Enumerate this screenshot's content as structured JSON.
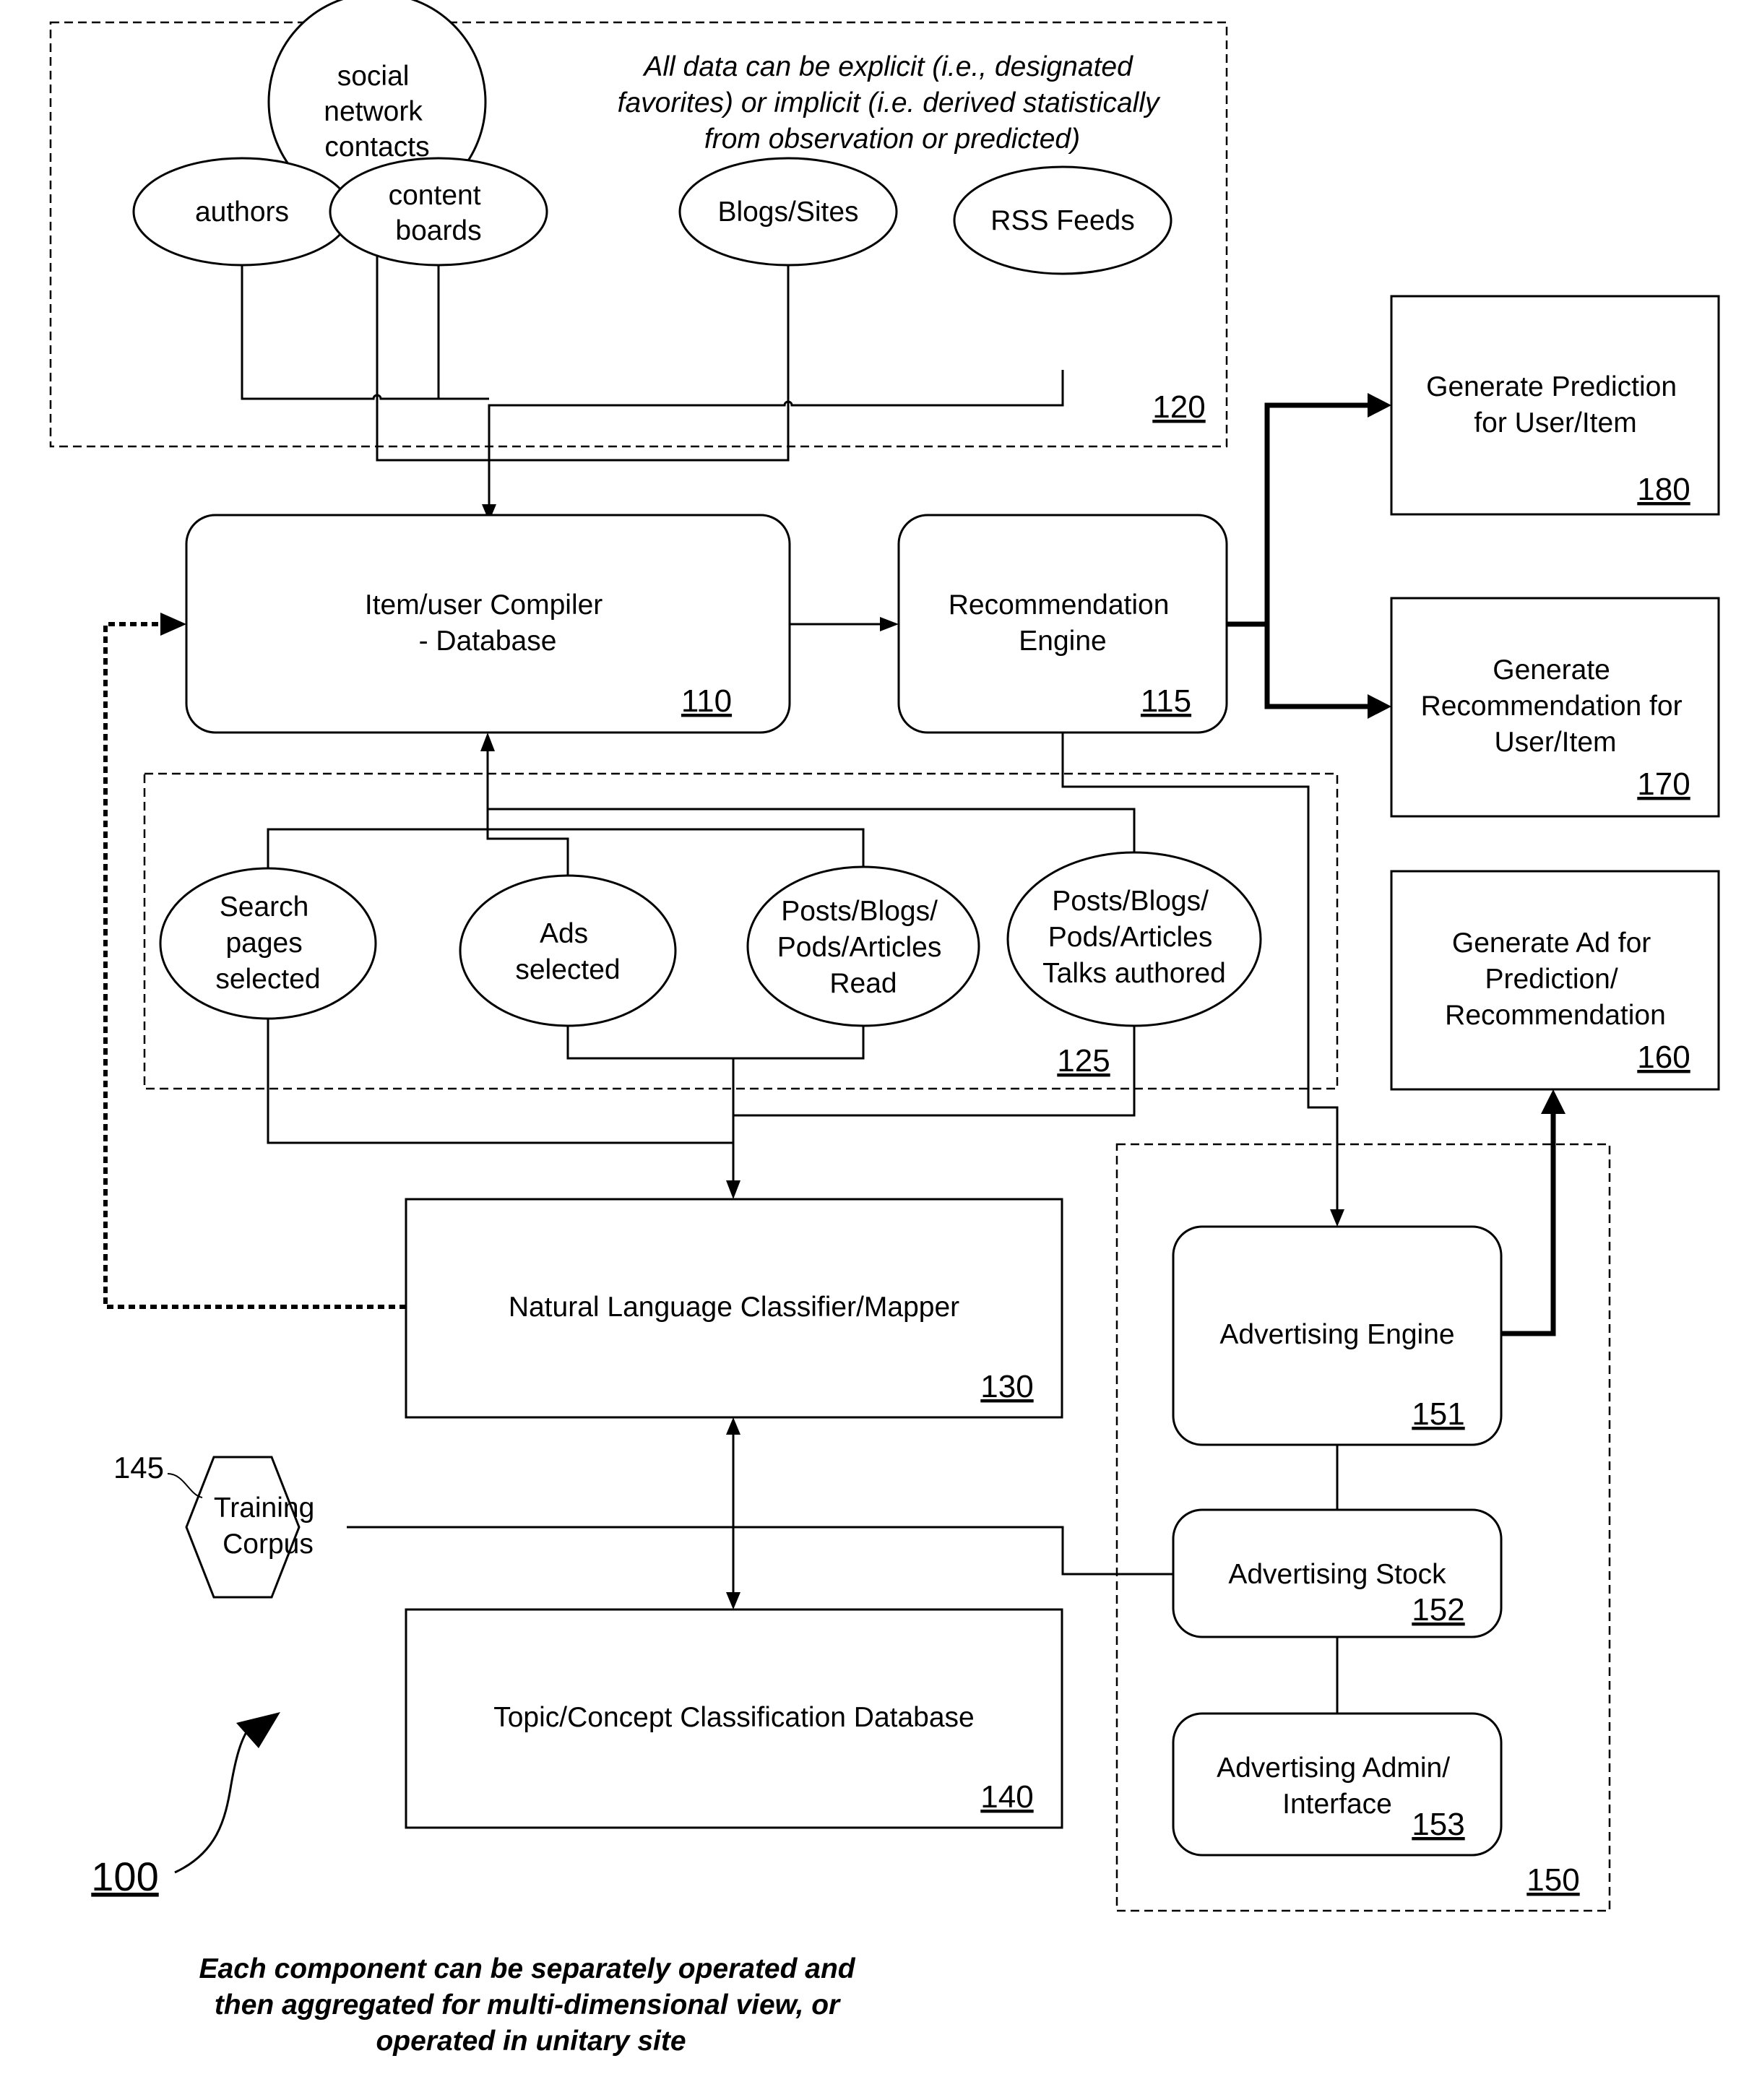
{
  "figure": {
    "figure_ref": "100",
    "footnote": [
      "Each component can be separately operated and",
      "then aggregated for multi-dimensional view, or",
      "operated in unitary site"
    ]
  },
  "group_120": {
    "ref": "120",
    "note": [
      "All data can be explicit (i.e., designated",
      "favorites) or implicit (i.e. derived statistically",
      "from observation or predicted)"
    ],
    "sources": [
      {
        "id": "social",
        "lines": [
          "social",
          "network",
          "contacts"
        ]
      },
      {
        "id": "authors",
        "lines": [
          "authors"
        ]
      },
      {
        "id": "boards",
        "lines": [
          "content",
          "boards"
        ]
      },
      {
        "id": "blogs",
        "lines": [
          "Blogs/Sites"
        ]
      },
      {
        "id": "rss",
        "lines": [
          "RSS Feeds"
        ]
      }
    ]
  },
  "group_125": {
    "ref": "125",
    "sources": [
      {
        "id": "search",
        "lines": [
          "Search",
          "pages",
          "selected"
        ]
      },
      {
        "id": "ads",
        "lines": [
          "Ads",
          "selected"
        ]
      },
      {
        "id": "read",
        "lines": [
          "Posts/Blogs/",
          "Pods/Articles",
          "Read"
        ]
      },
      {
        "id": "authored",
        "lines": [
          "Posts/Blogs/",
          "Pods/Articles",
          "Talks authored"
        ]
      }
    ]
  },
  "nodes": {
    "compiler": {
      "ref": "110",
      "lines": [
        "Item/user Compiler",
        "- Database"
      ]
    },
    "rec_engine": {
      "ref": "115",
      "lines": [
        "Recommendation",
        "Engine"
      ]
    },
    "prediction": {
      "ref": "180",
      "lines": [
        "Generate Prediction",
        "for User/Item"
      ]
    },
    "recommendation": {
      "ref": "170",
      "lines": [
        "Generate",
        "Recommendation for",
        "User/Item"
      ]
    },
    "gen_ad": {
      "ref": "160",
      "lines": [
        "Generate Ad for",
        "Prediction/",
        "Recommendation"
      ]
    },
    "nl_classifier": {
      "ref": "130",
      "lines": [
        "Natural Language Classifier/Mapper"
      ]
    },
    "topic_db": {
      "ref": "140",
      "lines": [
        "Topic/Concept Classification Database"
      ]
    },
    "training": {
      "ref": "145",
      "lines": [
        "Training",
        "Corpus"
      ]
    },
    "ad_engine": {
      "ref": "151",
      "lines": [
        "Advertising Engine"
      ]
    },
    "ad_stock": {
      "ref": "152",
      "lines": [
        "Advertising Stock"
      ]
    },
    "ad_admin": {
      "ref": "153",
      "lines": [
        "Advertising Admin/",
        "Interface"
      ]
    }
  },
  "group_150": {
    "ref": "150"
  }
}
